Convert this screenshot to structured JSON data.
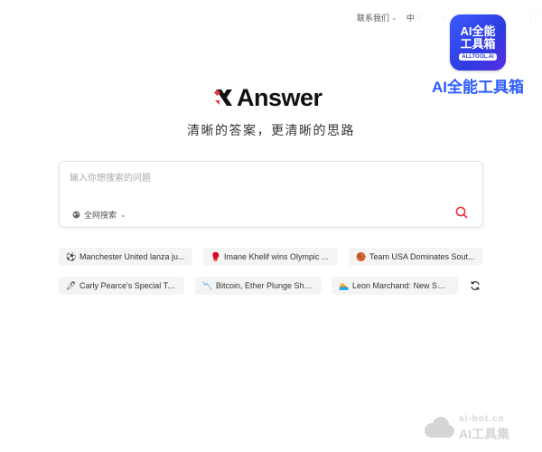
{
  "topbar": {
    "contact_label": "联系我们",
    "language_label": "中文",
    "pro_label": "P"
  },
  "watermark": {
    "icon_line1": "AI全能",
    "icon_line2": "工具箱",
    "icon_line3": "ALLTOOL.AI",
    "text": "AI全能工具箱",
    "bottom_line1": "ai-bot.cn",
    "bottom_line2": "AI工具集"
  },
  "logo": {
    "word": "Answer"
  },
  "slogan": "清晰的答案，更清晰的思路",
  "search": {
    "placeholder": "输入你想搜索的问题",
    "value": "",
    "scope_label": "全网搜索"
  },
  "suggestions": [
    {
      "icon": "⚽",
      "icon_name": "soccer-ball-icon",
      "label": "Manchester United lanza ju..."
    },
    {
      "icon": "🥊",
      "icon_name": "boxing-glove-icon",
      "label": "Imane Khelif wins Olympic ..."
    },
    {
      "icon": "🏀",
      "icon_name": "basketball-icon",
      "label": "Team USA Dominates Sout..."
    },
    {
      "icon": "🖊",
      "icon_name": "pen-icon",
      "label": "Carly Pearce's Special Ta..."
    },
    {
      "icon": "📉",
      "icon_name": "chart-down-icon",
      "label": "Bitcoin, Ether Plunge Shar..."
    },
    {
      "icon": "🏊",
      "icon_name": "swimmer-icon",
      "label": "Leon Marchand: New Swi..."
    }
  ],
  "colors": {
    "brand_red": "#e8343f",
    "search_icon": "#e8343f",
    "watermark_blue": "#2d5bff"
  }
}
